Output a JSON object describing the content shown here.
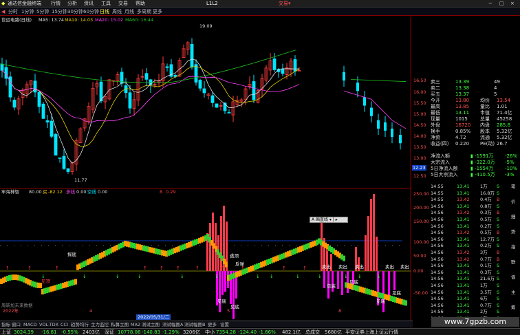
{
  "colors": {
    "up": "#ff3c3c",
    "down": "#00e5ff",
    "ma5": "#e0e0e0",
    "ma10": "#e8d000",
    "ma20": "#ff40ff",
    "ma60": "#20c020",
    "volume_magenta": "#ff00ff",
    "bg": "#000000"
  },
  "app": {
    "title": "通达信金融终端",
    "menus": [
      "行情",
      "分析",
      "资讯",
      "工具",
      "交易",
      "帮助"
    ],
    "connection": "L1L2",
    "trade_link": "交易▾",
    "window_icons": [
      "−",
      "□",
      "×"
    ]
  },
  "periods": {
    "items": [
      "分时",
      "1分钟",
      "5分钟",
      "15分钟",
      "30分钟",
      "60分钟",
      "日线",
      "周线",
      "月线",
      "多周期",
      "更多"
    ],
    "active": "日线"
  },
  "stock": {
    "name": "世运电路(日线)",
    "ma5_label": "MA5: 13.74",
    "ma10_label": "MA10: 14.03",
    "ma20_label": "MA20: 15.02",
    "ma60_label": "MA60: 16.44"
  },
  "price_axis": {
    "labels": [
      "16.50",
      "16.00",
      "15.50",
      "15.00",
      "14.50",
      "14.00",
      "13.50",
      "13.00",
      "12.50"
    ],
    "current": "12.23"
  },
  "annotations": {
    "high": "19.09",
    "low": "11.77"
  },
  "indicator": {
    "name": "牢海神智",
    "param1": "80.00",
    "param2_label": "买",
    "param2": "-82.12",
    "param3_label": "多线",
    "param3": "0.00",
    "param4_label": "空线",
    "param4": "0.00",
    "b_label": "B",
    "b_value": "0.29"
  },
  "indicator_axis": {
    "labels": [
      "250.00",
      "200.00",
      "150.00",
      "100.00",
      "50.00",
      "0.00",
      "-50.00"
    ]
  },
  "signals": {
    "buy": "买入",
    "sell": "卖出",
    "bottom": "见底",
    "top": "见顶",
    "rebound": "反弹",
    "exit": "逃顶",
    "rally": "探底"
  },
  "timeline": {
    "year": "2022年",
    "month_a": "4",
    "month_b": "5",
    "month_c": "8",
    "cursor_date": "2022/05/31/二",
    "brand": "周新加未来数据"
  },
  "quote": {
    "rows": [
      {
        "k": "卖三",
        "v": "13.39",
        "vc": "#40ff40",
        "r": "49",
        "rc": "#ddd"
      },
      {
        "k": "卖二",
        "v": "13.38",
        "vc": "#40ff40",
        "r": "4",
        "rc": "#ddd"
      },
      {
        "k": "买五",
        "v": "13.37",
        "vc": "#40ff40",
        "r": "5",
        "rc": "#ddd"
      },
      {
        "k": "今开",
        "v": "13.80",
        "vc": "#ff5050",
        "k2": "均价",
        "v2": "13.54",
        "v2c": "#ff5050"
      },
      {
        "k": "最高",
        "v": "13.85",
        "vc": "#ff5050",
        "k2": "量比",
        "v2": "1.01",
        "v2c": "#ddd"
      },
      {
        "k": "最低",
        "v": "13.11",
        "vc": "#40ff40",
        "k2": "市值",
        "v2": "71.4亿",
        "v2c": "#ddd"
      },
      {
        "k": "现量",
        "v": "1015",
        "vc": "#ddd",
        "k2": "总量",
        "v2": "45258",
        "v2c": "#ddd"
      },
      {
        "k": "外盘",
        "v": "16720",
        "vc": "#ff5050",
        "k2": "内盘",
        "v2": "285.8",
        "v2c": "#40ff40"
      },
      {
        "k": "换手",
        "v": "0.85%",
        "vc": "#ddd",
        "k2": "股本",
        "v2": "5.32亿",
        "v2c": "#ddd"
      },
      {
        "k": "净资",
        "v": "4.72",
        "vc": "#ddd",
        "k2": "流通",
        "v2": "5.32亿",
        "v2c": "#ddd"
      },
      {
        "k": "收益(四)",
        "v": "0.220",
        "vc": "#ddd",
        "k2": "PE(动)",
        "v2": "26.7",
        "v2c": "#ddd"
      }
    ],
    "flows": [
      {
        "k": "净流入额",
        "v": "-1591万",
        "p": "-26%"
      },
      {
        "k": "大宗流入",
        "v": "-322.0万",
        "p": "-5%"
      },
      {
        "k": "5日净流入额",
        "v": "-1554万",
        "p": "-10%"
      },
      {
        "k": "5日大宗流入",
        "v": "-410.5万",
        "p": "-3%"
      }
    ]
  },
  "ticks": [
    {
      "t": "14:55",
      "p": "13.41",
      "v": "1",
      "d": "万",
      "s": "S"
    },
    {
      "t": "14:55",
      "p": "13.41",
      "v": "16.8",
      "d": "万",
      "s": "S"
    },
    {
      "t": "14:55",
      "p": "13.42",
      "v": "0.4",
      "d": "万",
      "s": "B"
    },
    {
      "t": "14:56",
      "p": "13.41",
      "v": "0.8",
      "d": "万",
      "s": "S"
    },
    {
      "t": "14:56",
      "p": "13.42",
      "v": "0.3",
      "d": "万",
      "s": "B"
    },
    {
      "t": "14:56",
      "p": "13.41",
      "v": "0.5",
      "d": "万",
      "s": "S"
    },
    {
      "t": "14:56",
      "p": "13.41",
      "v": "0.2",
      "d": "万",
      "s": "S"
    },
    {
      "t": "14:56",
      "p": "13.42",
      "v": "0.5",
      "d": "万",
      "s": "B"
    },
    {
      "t": "14:56",
      "p": "13.41",
      "v": "12.7",
      "d": "万",
      "s": "S"
    },
    {
      "t": "14:56",
      "p": "13.41",
      "v": "0.2",
      "d": "万",
      "s": "S"
    },
    {
      "t": "14:56",
      "p": "13.42",
      "v": "3",
      "d": "万",
      "s": "B"
    },
    {
      "t": "14:56",
      "p": "13.42",
      "v": "0.7",
      "d": "万",
      "s": "B"
    },
    {
      "t": "14:56",
      "p": "13.41",
      "v": "0.1",
      "d": "万",
      "s": "S"
    },
    {
      "t": "14:56",
      "p": "13.41",
      "v": "0.3",
      "d": "万",
      "s": "S"
    },
    {
      "t": "14:56",
      "p": "13.41",
      "v": "21.6",
      "d": "万",
      "s": "S"
    },
    {
      "t": "14:56",
      "p": "13.41",
      "v": "1",
      "d": "万",
      "s": "S"
    },
    {
      "t": "14:56",
      "p": "13.41",
      "v": "3.5",
      "d": "万",
      "s": "S"
    },
    {
      "t": "14:56",
      "p": "13.41",
      "v": "6",
      "d": "万",
      "s": "S"
    },
    {
      "t": "14:56",
      "p": "13.41",
      "v": "0.7",
      "d": "万",
      "s": "S"
    },
    {
      "t": "14:56",
      "p": "13.41",
      "v": "2",
      "d": "万",
      "s": "S"
    },
    {
      "t": "14:56",
      "p": "13.41",
      "v": "4",
      "d": "万",
      "s": "S"
    }
  ],
  "side_tabs": [
    "笔",
    "价",
    "细",
    "势",
    "指",
    "联",
    "值",
    "主",
    "筹"
  ],
  "bottom_tabs": [
    "指标",
    "窗口",
    "MACD",
    "VOL-TDX",
    "CCI",
    "趋势均行",
    "主力监控",
    "私募主图",
    "MA2",
    "测试主图",
    "测试幅图A",
    "测试幅图B",
    "更多",
    "设置"
  ],
  "bottom_tabs2": [
    "扩展▲",
    "关联报价",
    "资金分布",
    "综合资讯",
    "行业资讯",
    "互动问答",
    "省用户属利专享"
  ],
  "mini_toolbar": "A 画直线 ▾ | ▸",
  "status": {
    "sh_label": "上证",
    "sh_value": "3024.39",
    "sh_change": "-16.81",
    "sh_pct": "-0.55%",
    "sh_amount": "2403亿",
    "sz_label": "深证",
    "sz_value": "10778.06",
    "sz_change": "-140.83",
    "sz_pct": "-1.29%",
    "sz_amount": "3206亿",
    "zx_label": "中小",
    "zx_value": "7354.28",
    "zx_change": "-124.40",
    "zx_pct": "-1.66%",
    "zx_amount": "482.1亿",
    "cy_label": "总成交",
    "cy_amount": "5680亿",
    "broker": "平安证券上海上证云行情",
    "hint": "图文F10"
  },
  "watermark": "www.7gpzb.com"
}
